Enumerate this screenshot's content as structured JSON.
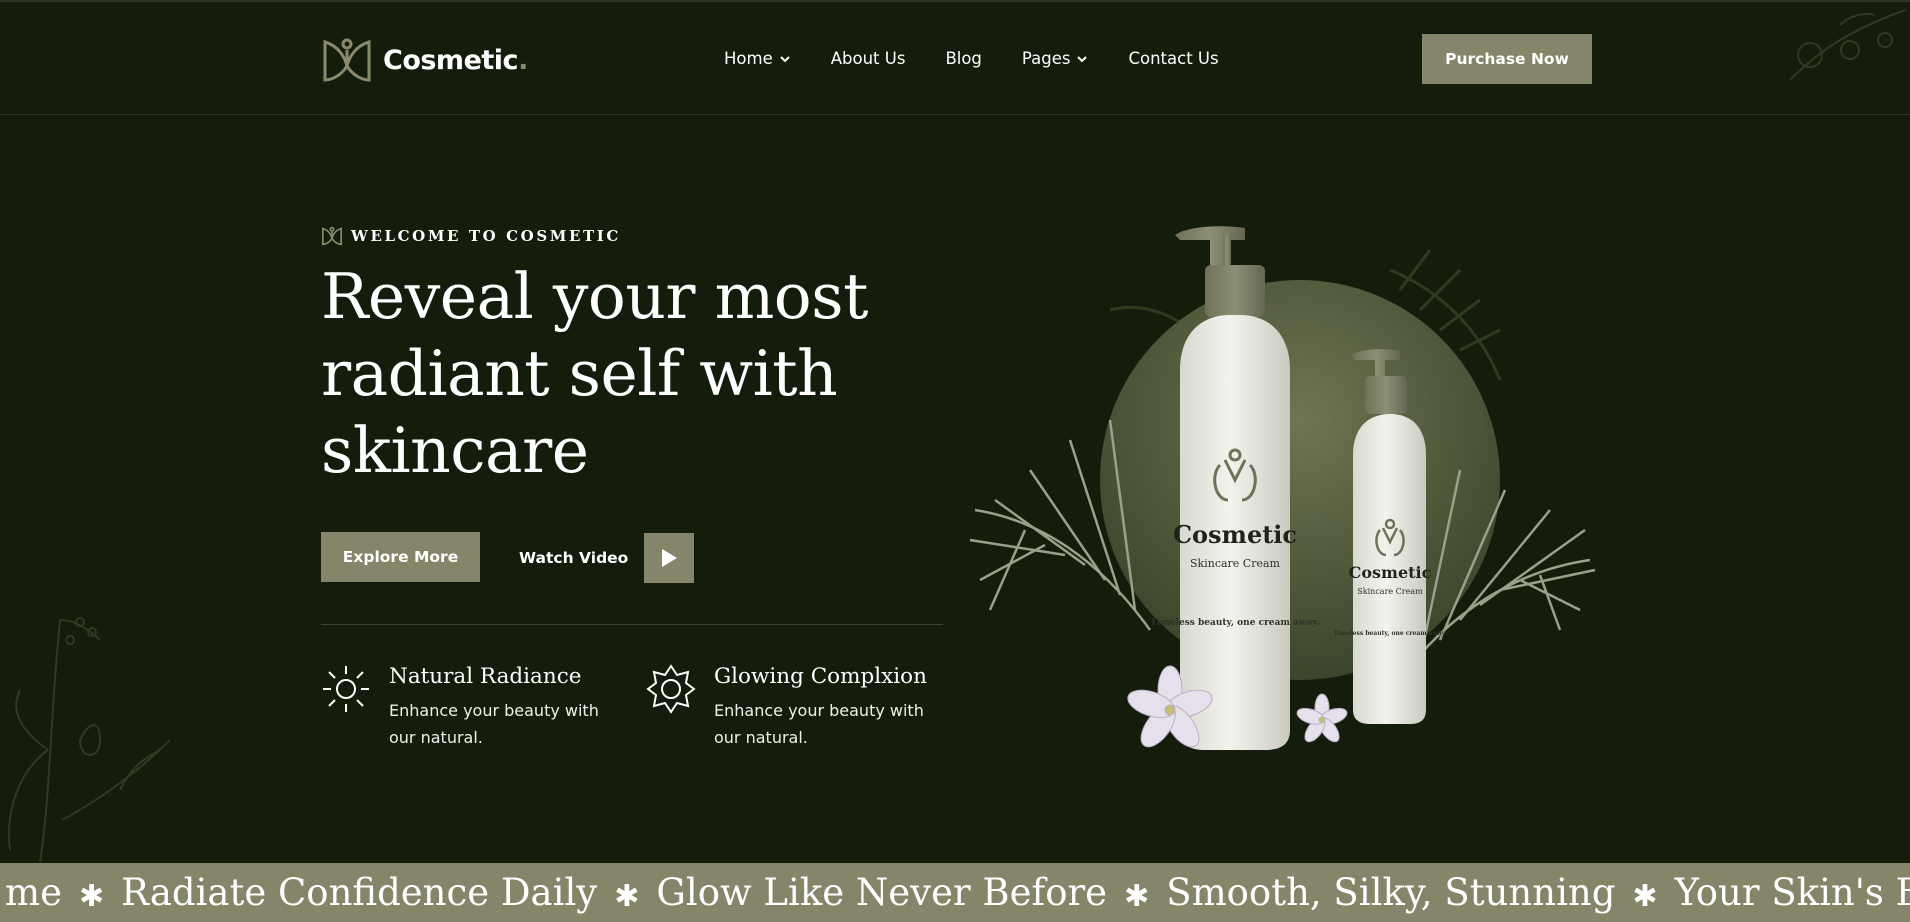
{
  "brand": {
    "name": "Cosmetic",
    "dot": "."
  },
  "nav": {
    "items": [
      {
        "label": "Home",
        "has_dropdown": true
      },
      {
        "label": "About Us",
        "has_dropdown": false
      },
      {
        "label": "Blog",
        "has_dropdown": false
      },
      {
        "label": "Pages",
        "has_dropdown": true
      },
      {
        "label": "Contact Us",
        "has_dropdown": false
      }
    ],
    "cta_label": "Purchase Now"
  },
  "hero": {
    "eyebrow": "WELCOME TO COSMETIC",
    "title": "Reveal your most radiant self with skincare",
    "explore_label": "Explore More",
    "watch_label": "Watch Video",
    "features": [
      {
        "icon": "sun-icon",
        "title": "Natural Radiance",
        "desc": "Enhance your beauty with our natural."
      },
      {
        "icon": "star-badge-icon",
        "title": "Glowing Complxion",
        "desc": "Enhance your beauty with our natural."
      }
    ],
    "product": {
      "large": {
        "brand": "Cosmetic",
        "sub": "Skincare Cream",
        "tagline": "Timeless beauty, one cream away."
      },
      "small": {
        "brand": "Cosmetic",
        "sub": "Skincare Cream",
        "tagline": "Timeless beauty, one cream away."
      }
    }
  },
  "marquee": {
    "items": [
      "me",
      "Radiate Confidence Daily",
      "Glow Like Never Before",
      "Smooth, Silky, Stunning",
      "Your Skin's Best Friend"
    ]
  },
  "colors": {
    "background": "#141d0c",
    "accent": "#858569",
    "text": "#ffffff"
  }
}
